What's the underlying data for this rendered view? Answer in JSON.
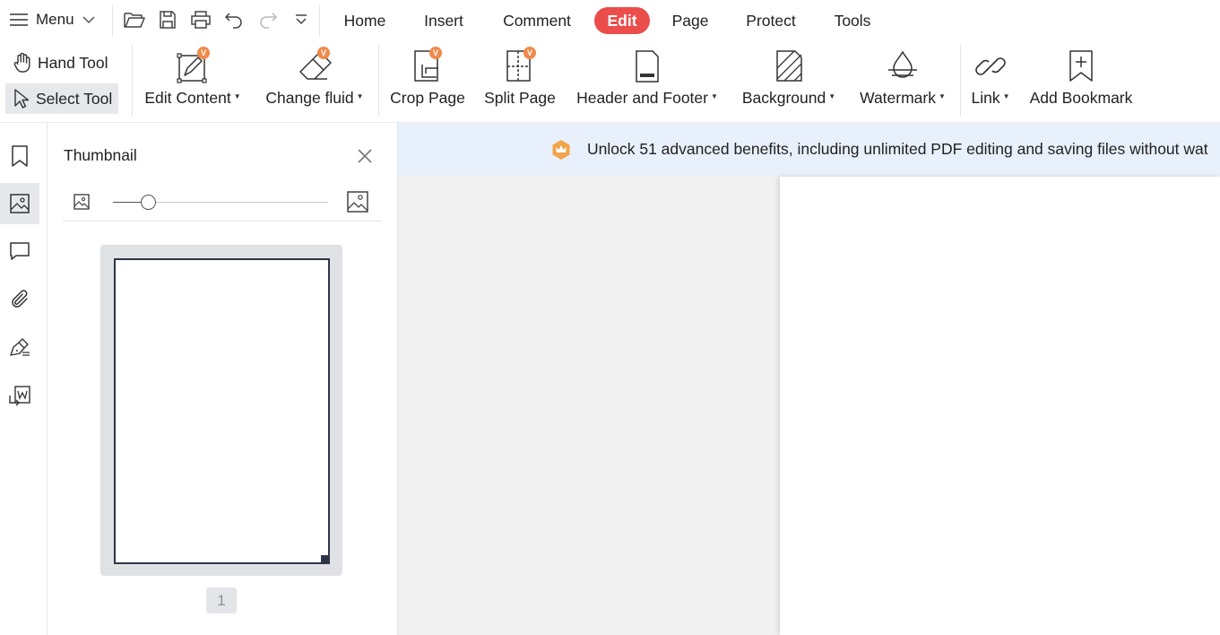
{
  "menu": {
    "label": "Menu"
  },
  "tabs": [
    {
      "label": "Home"
    },
    {
      "label": "Insert"
    },
    {
      "label": "Comment"
    },
    {
      "label": "Edit"
    },
    {
      "label": "Page"
    },
    {
      "label": "Protect"
    },
    {
      "label": "Tools"
    }
  ],
  "active_tab": "Edit",
  "ribbon": {
    "hand_tool": "Hand Tool",
    "select_tool": "Select Tool",
    "edit_content": "Edit Content",
    "change_fluid": "Change fluid",
    "crop_page": "Crop Page",
    "split_page": "Split Page",
    "header_footer": "Header and Footer",
    "background": "Background",
    "watermark": "Watermark",
    "link": "Link",
    "add_bookmark": "Add Bookmark",
    "premium_badge": "V"
  },
  "thumbnail_panel": {
    "title": "Thumbnail",
    "page_number": "1",
    "thumb_size_level": 0.15
  },
  "banner": {
    "text": "Unlock 51 advanced benefits, including unlimited PDF editing and saving files without wat"
  },
  "colors": {
    "accent_red": "#eb4d4b",
    "premium_orange": "#ef8a4a",
    "banner_bg": "#e8f0fb",
    "selected_bg": "#e6e8ec"
  }
}
